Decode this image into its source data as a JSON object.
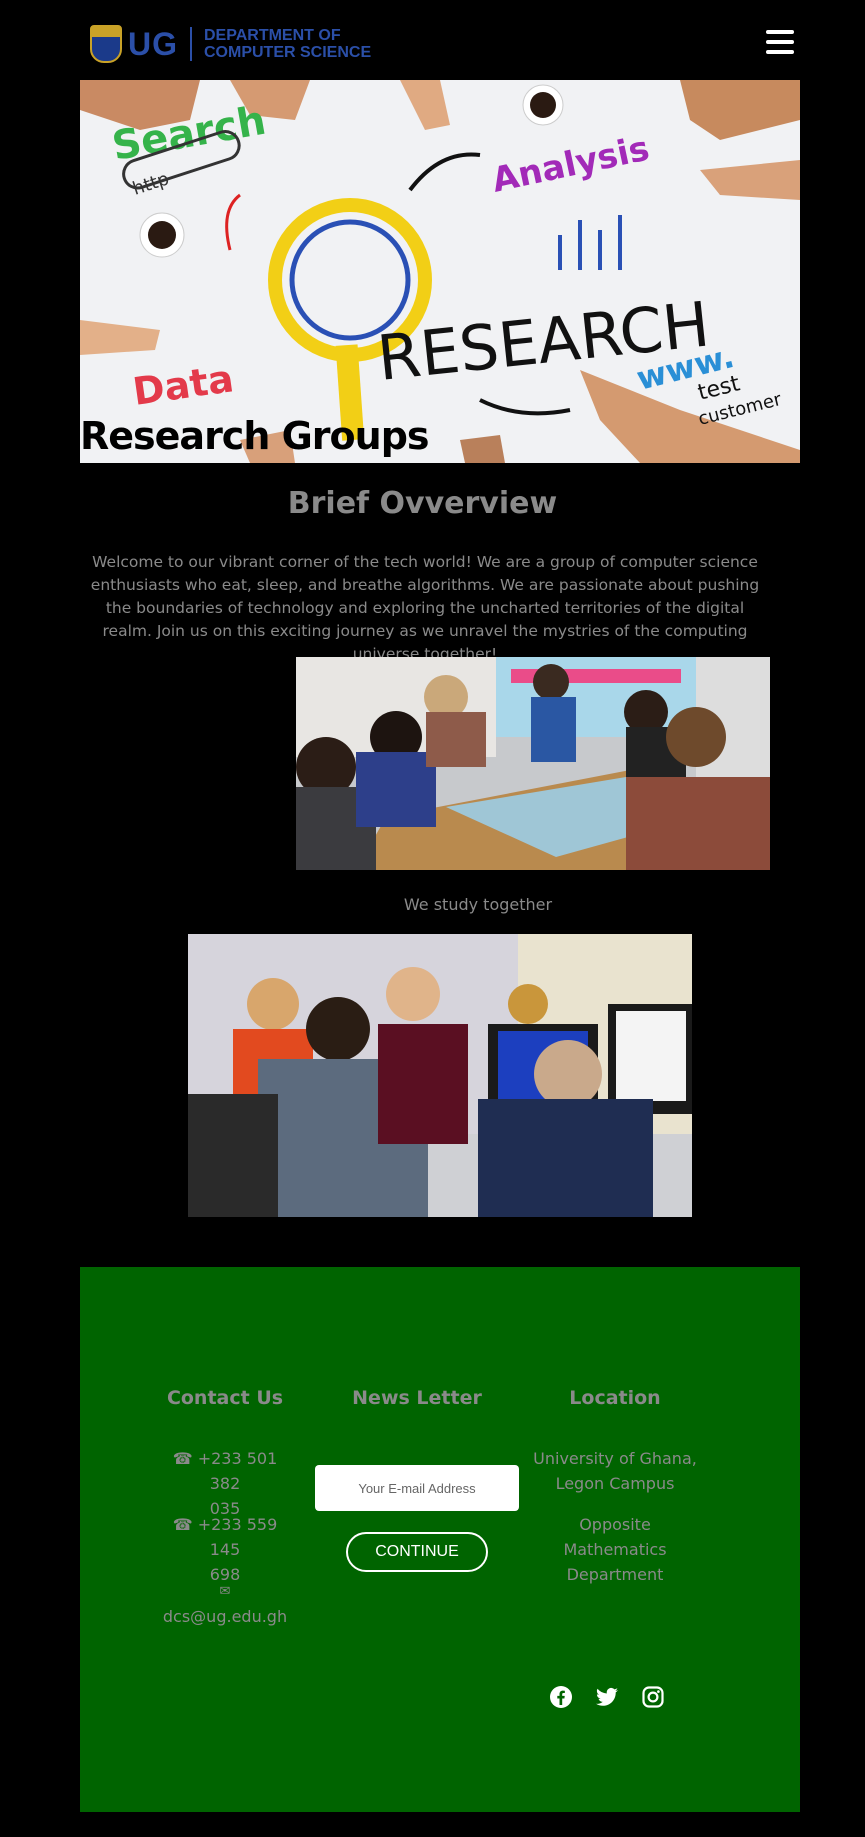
{
  "header": {
    "logo_abbr": "UG",
    "logo_line1": "DEPARTMENT OF",
    "logo_line2": "COMPUTER SCIENCE",
    "menu_icon": "hamburger-menu-icon"
  },
  "hero": {
    "title": "Research Groups",
    "image_words": [
      "Search",
      "http",
      "Analysis",
      "RESEARCH",
      "Data",
      "www.",
      "test",
      "customer"
    ]
  },
  "overview": {
    "title": "Brief Ovverview",
    "text": "Welcome to our vibrant corner of the tech world! We are a group of computer science enthusiasts who eat, sleep, and breathe algorithms. We are passionate about pushing the boundaries of technology and exploring the uncharted territories of the digital realm. Join us on this exciting journey as we unravel the mystries of the computing universe together!",
    "caption": "We study together"
  },
  "footer": {
    "contact": {
      "title": "Contact Us",
      "phone1_line1": "☎ +233 501 382",
      "phone1_line2": "035",
      "phone2_line1": "☎ +233 559 145",
      "phone2_line2": "698",
      "email_icon": "✉",
      "email": "dcs@ug.edu.gh"
    },
    "newsletter": {
      "title": "News Letter",
      "placeholder": "Your E-mail Address",
      "button": "CONTINUE"
    },
    "location": {
      "title": "Location",
      "line1": "University of Ghana,",
      "line2": "Legon Campus",
      "line3": "Opposite",
      "line4": "Mathematics",
      "line5": "Department"
    },
    "social_icons": [
      "facebook-icon",
      "twitter-icon",
      "instagram-icon"
    ]
  },
  "colors": {
    "background": "#000000",
    "footer_green": "#006400",
    "text_gray": "#8a8a8a",
    "logo_blue": "#2b4fa8"
  }
}
